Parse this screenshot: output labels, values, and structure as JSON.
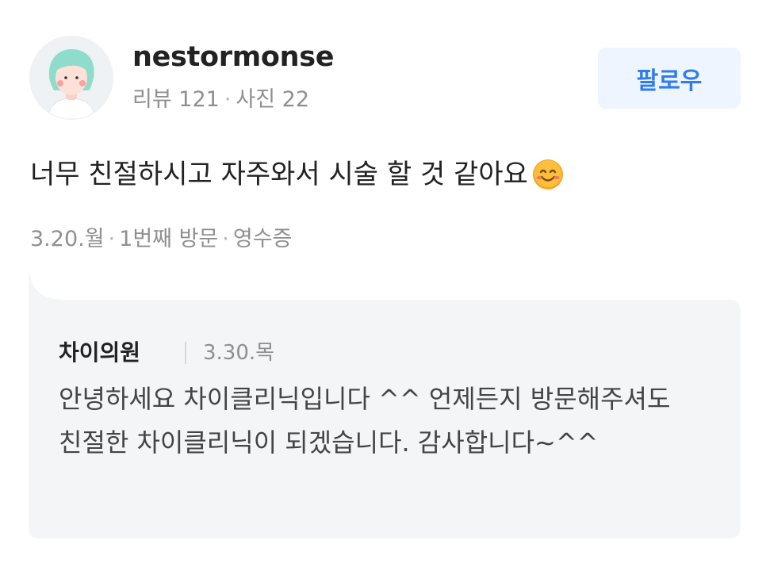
{
  "reviewer": {
    "username": "nestormonse",
    "review_count_label": "리뷰 121",
    "photo_count_label": "사진 22",
    "avatar": "avatar-illustration"
  },
  "follow_button": {
    "label": "팔로우"
  },
  "review": {
    "text": "너무 친절하시고 자주와서 시술 할 것 같아요",
    "emoji": "smiling-face-icon"
  },
  "visit": {
    "date": "3.20.월",
    "visit_count": "1번째 방문",
    "verification": "영수증"
  },
  "reply": {
    "owner_name": "차이의원",
    "date": "3.30.목",
    "text": "안녕하세요 차이클리닉입니다 ^^ 언제든지 방문해주셔도 친절한 차이클리닉이 되겠습니다. 감사합니다~^^"
  },
  "colors": {
    "accent": "#2f7cf0",
    "follow_bg": "#eef5fe",
    "reply_bg": "#f3f5f6",
    "text_primary": "#222222",
    "text_secondary": "#8f8f8f"
  }
}
